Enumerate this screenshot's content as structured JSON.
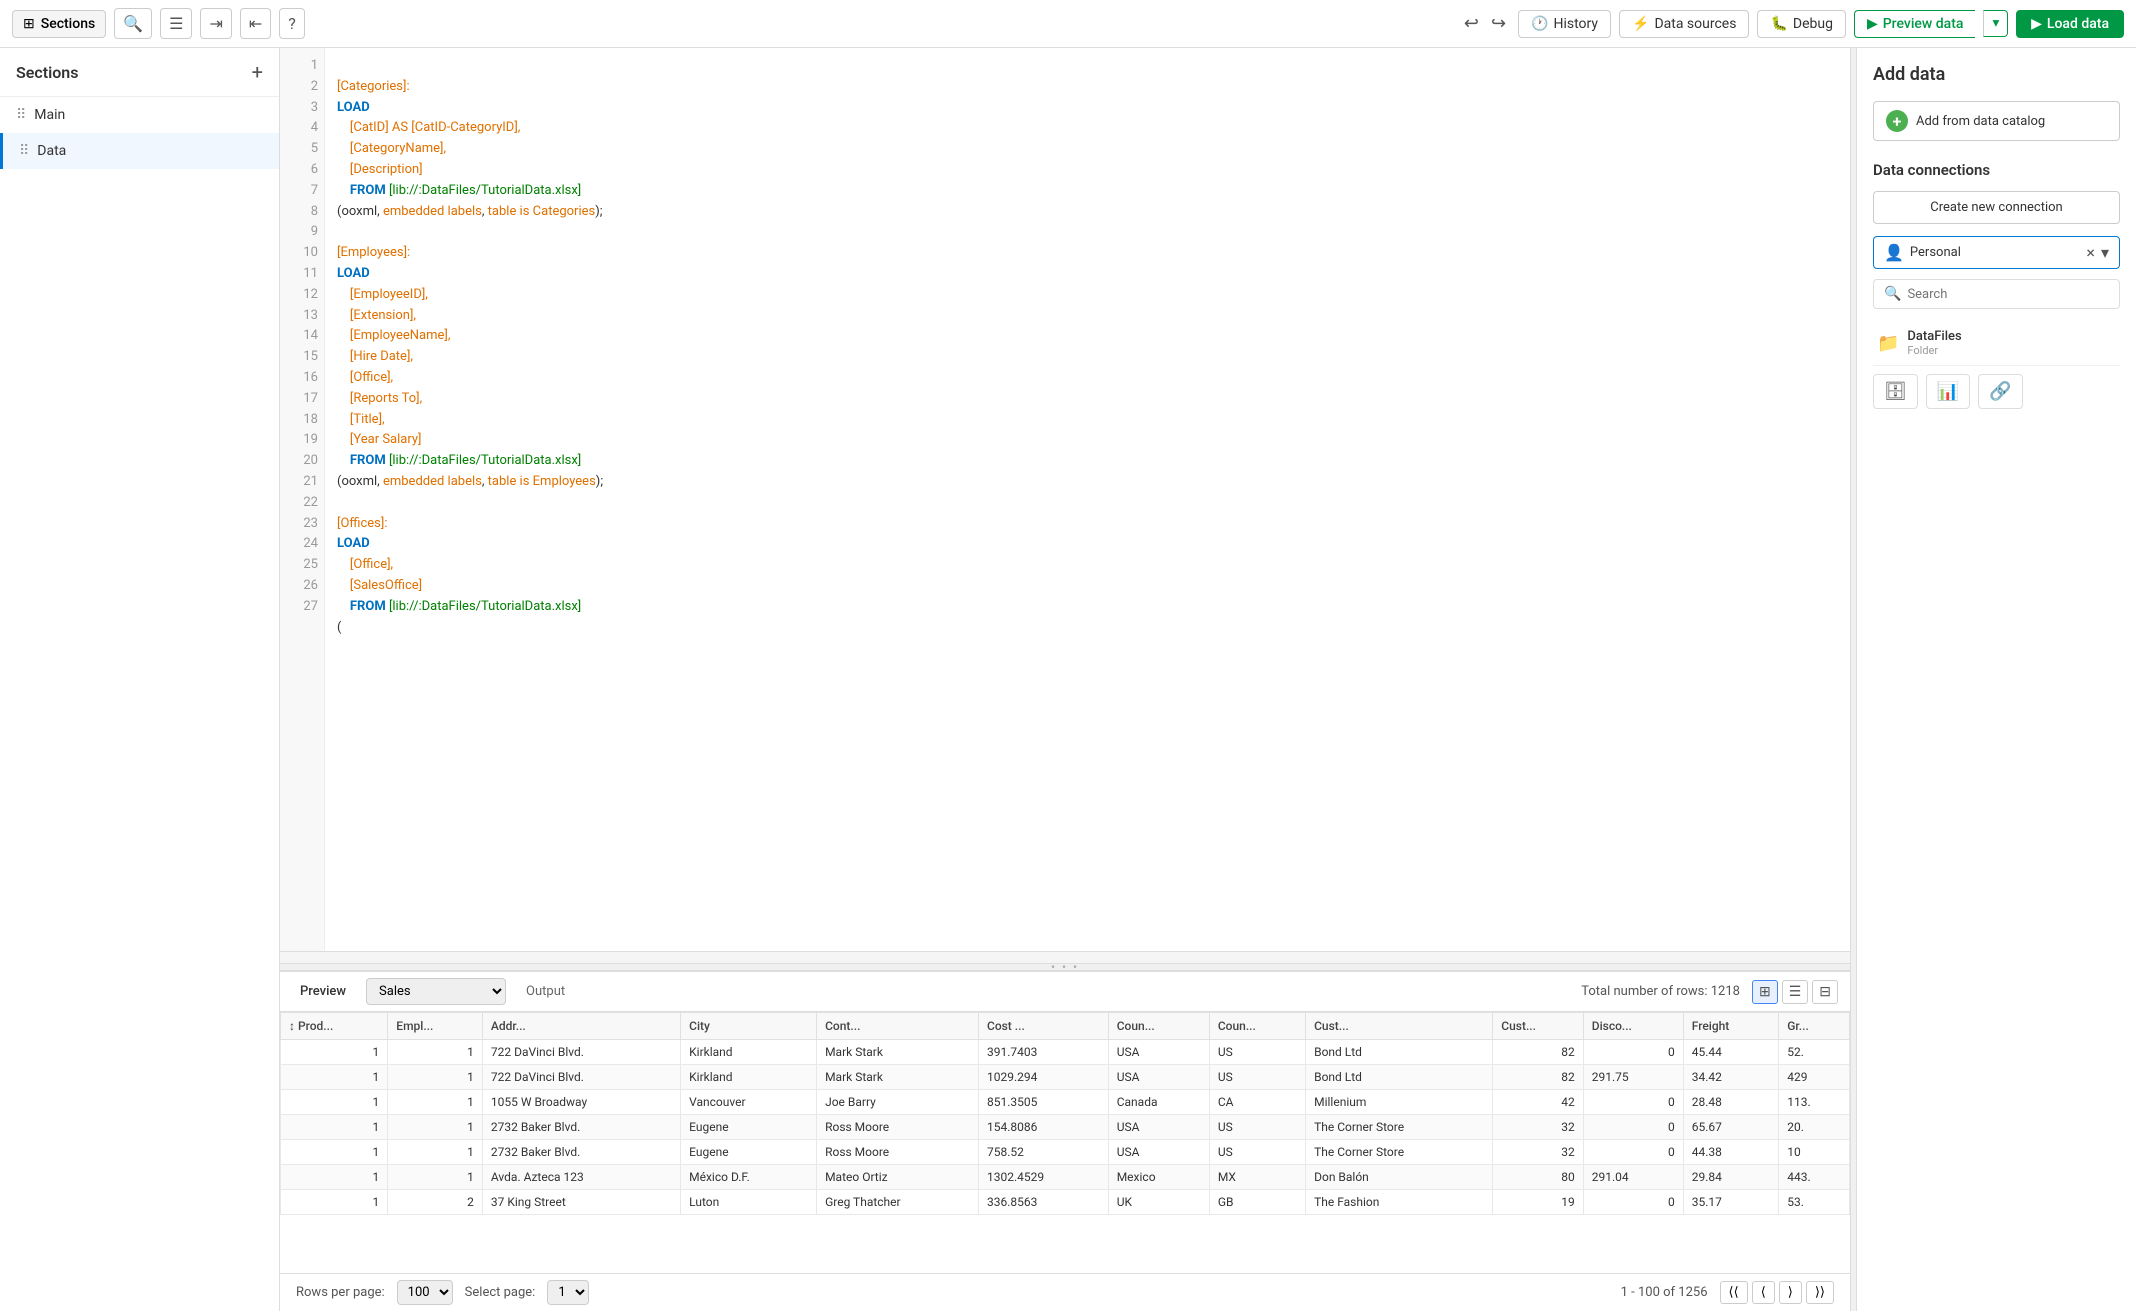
{
  "toolbar": {
    "sections_label": "Sections",
    "history_label": "History",
    "datasources_label": "Data sources",
    "debug_label": "Debug",
    "preview_label": "Preview data",
    "load_label": "Load data"
  },
  "sidebar": {
    "title": "Sections",
    "add_label": "+",
    "items": [
      {
        "label": "Main",
        "active": false
      },
      {
        "label": "Data",
        "active": true
      }
    ]
  },
  "editor": {
    "lines": [
      {
        "num": 1,
        "code": "[Categories]:",
        "type": "field"
      },
      {
        "num": 2,
        "code": "LOAD",
        "type": "kw"
      },
      {
        "num": 3,
        "code": "    [CatID] AS [CatID-CategoryID],",
        "type": "field"
      },
      {
        "num": 4,
        "code": "    [CategoryName],",
        "type": "field"
      },
      {
        "num": 5,
        "code": "    [Description]",
        "type": "field"
      },
      {
        "num": 6,
        "code": "FROM [lib://:DataFiles/TutorialData.xlsx]",
        "type": "str"
      },
      {
        "num": 7,
        "code": "(ooxml, embedded labels, table is Categories);",
        "type": "plain"
      },
      {
        "num": 8,
        "code": "",
        "type": "plain"
      },
      {
        "num": 9,
        "code": "[Employees]:",
        "type": "field"
      },
      {
        "num": 10,
        "code": "LOAD",
        "type": "kw"
      },
      {
        "num": 11,
        "code": "    [EmployeeID],",
        "type": "field"
      },
      {
        "num": 12,
        "code": "    [Extension],",
        "type": "field"
      },
      {
        "num": 13,
        "code": "    [EmployeeName],",
        "type": "field"
      },
      {
        "num": 14,
        "code": "    [Hire Date],",
        "type": "field"
      },
      {
        "num": 15,
        "code": "    [Office],",
        "type": "field"
      },
      {
        "num": 16,
        "code": "    [Reports To],",
        "type": "field"
      },
      {
        "num": 17,
        "code": "    [Title],",
        "type": "field"
      },
      {
        "num": 18,
        "code": "    [Year Salary]",
        "type": "field"
      },
      {
        "num": 19,
        "code": "FROM [lib://:DataFiles/TutorialData.xlsx]",
        "type": "str"
      },
      {
        "num": 20,
        "code": "(ooxml, embedded labels, table is Employees);",
        "type": "plain"
      },
      {
        "num": 21,
        "code": "",
        "type": "plain"
      },
      {
        "num": 22,
        "code": "[Offices]:",
        "type": "field"
      },
      {
        "num": 23,
        "code": "LOAD",
        "type": "kw"
      },
      {
        "num": 24,
        "code": "    [Office],",
        "type": "field"
      },
      {
        "num": 25,
        "code": "    [SalesOffice]",
        "type": "field"
      },
      {
        "num": 26,
        "code": "FROM [lib://:DataFiles/TutorialData.xlsx]",
        "type": "str"
      },
      {
        "num": 27,
        "code": "(",
        "type": "plain"
      }
    ]
  },
  "right_panel": {
    "title": "Add data",
    "catalog_btn": "Add from data catalog",
    "connections_title": "Data connections",
    "create_connection": "Create new connection",
    "scope_text": "Personal",
    "search_placeholder": "Search",
    "folder": {
      "name": "DataFiles",
      "type": "Folder"
    }
  },
  "bottom_panel": {
    "preview_label": "Preview",
    "table_name": "Sales",
    "output_label": "Output",
    "row_count": "Total number of rows: 1218",
    "columns": [
      "Prod...",
      "Empl...",
      "Addr...",
      "City",
      "Cont...",
      "Cost ...",
      "Coun...",
      "Coun...",
      "Cust...",
      "Cust...",
      "Disco...",
      "Freight",
      "Gr..."
    ],
    "rows": [
      [
        1,
        1,
        "722 DaVinci Blvd.",
        "Kirkland",
        "Mark Stark",
        "391.7403",
        "USA",
        "US",
        "Bond Ltd",
        82,
        0,
        "45.44",
        "52."
      ],
      [
        1,
        1,
        "722 DaVinci Blvd.",
        "Kirkland",
        "Mark Stark",
        "1029.294",
        "USA",
        "US",
        "Bond Ltd",
        82,
        "291.75",
        "34.42",
        "429"
      ],
      [
        1,
        1,
        "1055 W Broadway",
        "Vancouver",
        "Joe Barry",
        "851.3505",
        "Canada",
        "CA",
        "Millenium",
        42,
        0,
        "28.48",
        "113."
      ],
      [
        1,
        1,
        "2732 Baker Blvd.",
        "Eugene",
        "Ross Moore",
        "154.8086",
        "USA",
        "US",
        "The Corner Store",
        32,
        0,
        "65.67",
        "20."
      ],
      [
        1,
        1,
        "2732 Baker Blvd.",
        "Eugene",
        "Ross Moore",
        "758.52",
        "USA",
        "US",
        "The Corner Store",
        32,
        0,
        "44.38",
        "10"
      ],
      [
        1,
        1,
        "Avda. Azteca 123",
        "México D.F.",
        "Mateo Ortiz",
        "1302.4529",
        "Mexico",
        "MX",
        "Don Balón",
        80,
        "291.04",
        "29.84",
        "443."
      ],
      [
        1,
        2,
        "37 King Street",
        "Luton",
        "Greg Thatcher",
        "336.8563",
        "UK",
        "GB",
        "The Fashion",
        19,
        0,
        "35.17",
        "53."
      ]
    ],
    "pagination": {
      "rows_per_page_label": "Rows per page:",
      "rows_per_page": "100",
      "select_page_label": "Select page:",
      "select_page": "1",
      "page_info": "1 - 100 of 1256"
    }
  }
}
